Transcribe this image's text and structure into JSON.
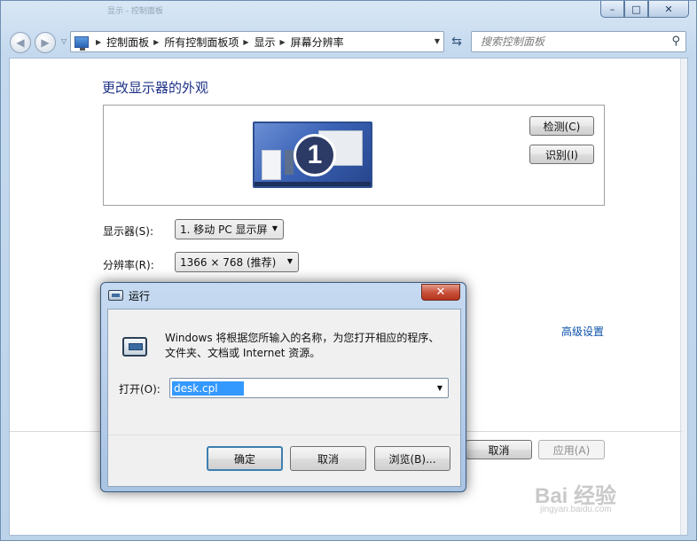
{
  "window": {
    "title_blur": "显示 - 控制面板",
    "caption": {
      "minimize": "–",
      "maximize": "□",
      "close": "✕"
    }
  },
  "nav": {
    "back_icon": "back-arrow-icon",
    "forward_icon": "forward-arrow-icon",
    "breadcrumbs": [
      "控制面板",
      "所有控制面板项",
      "显示",
      "屏幕分辨率"
    ],
    "search_placeholder": "搜索控制面板"
  },
  "main": {
    "title": "更改显示器的外观",
    "monitor_number": "1",
    "detect_button": "检测(C)",
    "identify_button": "识别(I)",
    "display_label": "显示器(S):",
    "display_value": "1. 移动 PC 显示屏",
    "resolution_label": "分辨率(R):",
    "resolution_value": "1366 × 768 (推荐)",
    "advanced_link": "高级设置",
    "cancel_button": "取消",
    "apply_button": "应用(A)"
  },
  "run_dialog": {
    "title": "运行",
    "description": "Windows 将根据您所输入的名称，为您打开相应的程序、文件夹、文档或 Internet 资源。",
    "open_label": "打开(O):",
    "input_value": "desk.cpl",
    "ok_button": "确定",
    "cancel_button": "取消",
    "browse_button": "浏览(B)..."
  },
  "watermark": {
    "brand": "Bai 经验",
    "url": "jingyan.baidu.com"
  }
}
